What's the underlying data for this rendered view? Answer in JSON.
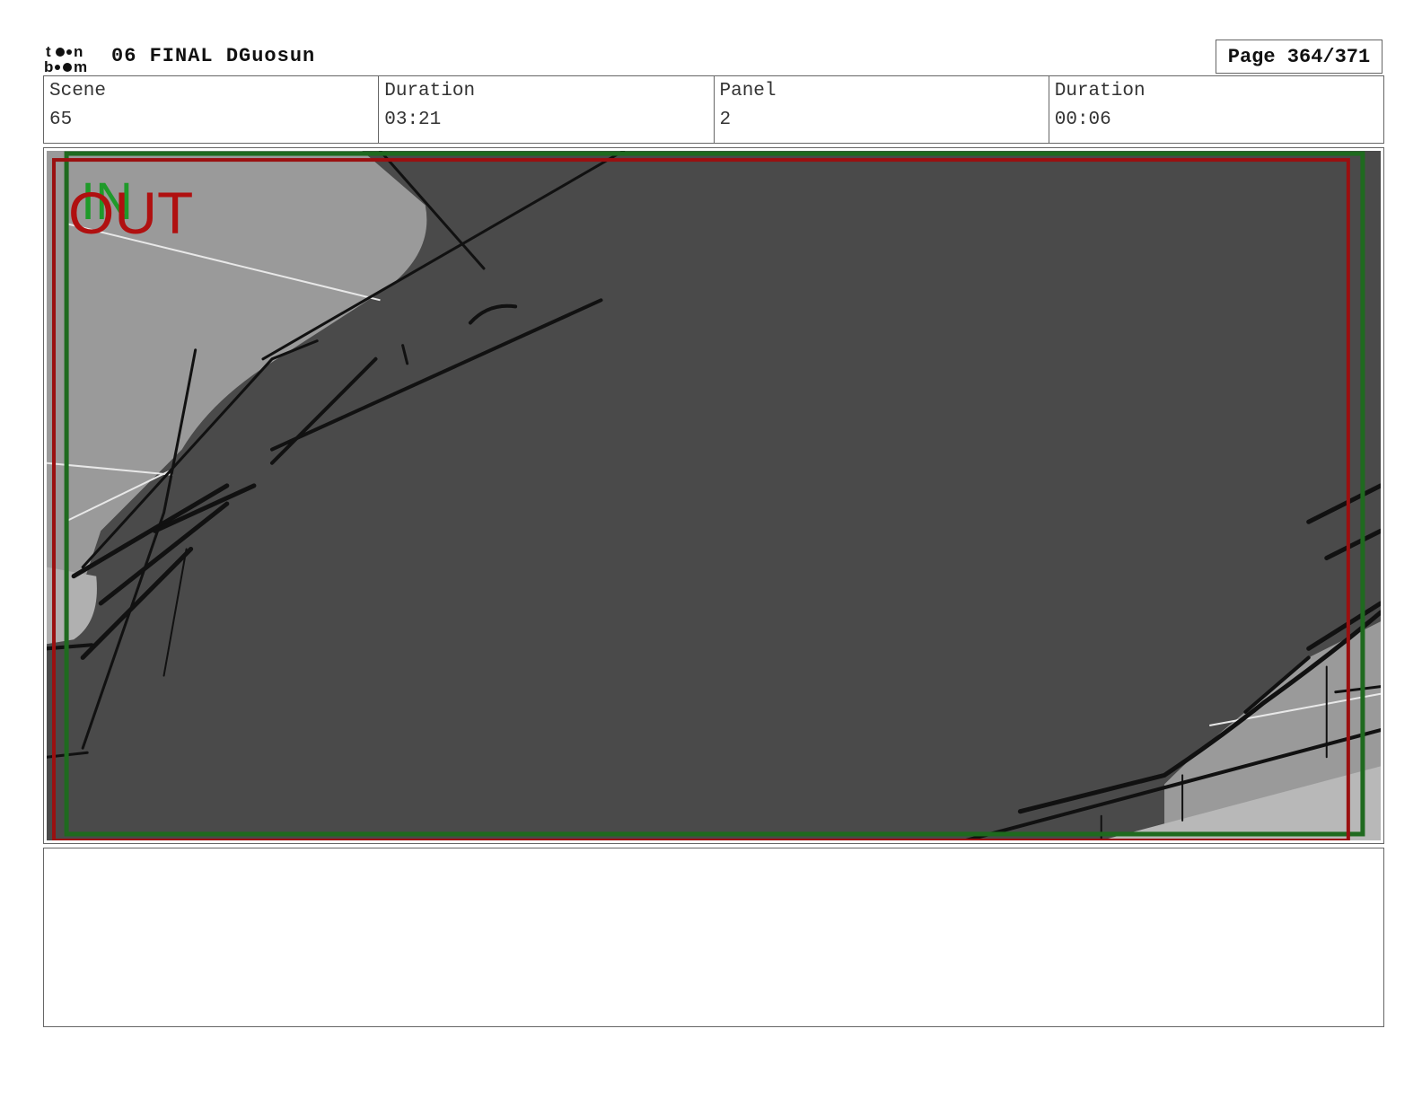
{
  "header": {
    "logo": "toonboom-logo",
    "title": "06 FINAL DGuosun",
    "page": "Page 364/371"
  },
  "info": {
    "scene_label": "Scene",
    "scene_value": "65",
    "scene_duration_label": "Duration",
    "scene_duration_value": "03:21",
    "panel_label": "Panel",
    "panel_value": "2",
    "panel_duration_label": "Duration",
    "panel_duration_value": "00:06"
  },
  "frame": {
    "in_marker": "IN",
    "out_marker": "OUT",
    "in_color": "#1f9a2a",
    "out_color": "#b01010",
    "background_color": "#4a4a4a",
    "sky_color": "#9a9a9a"
  },
  "notes": {
    "text": ""
  }
}
